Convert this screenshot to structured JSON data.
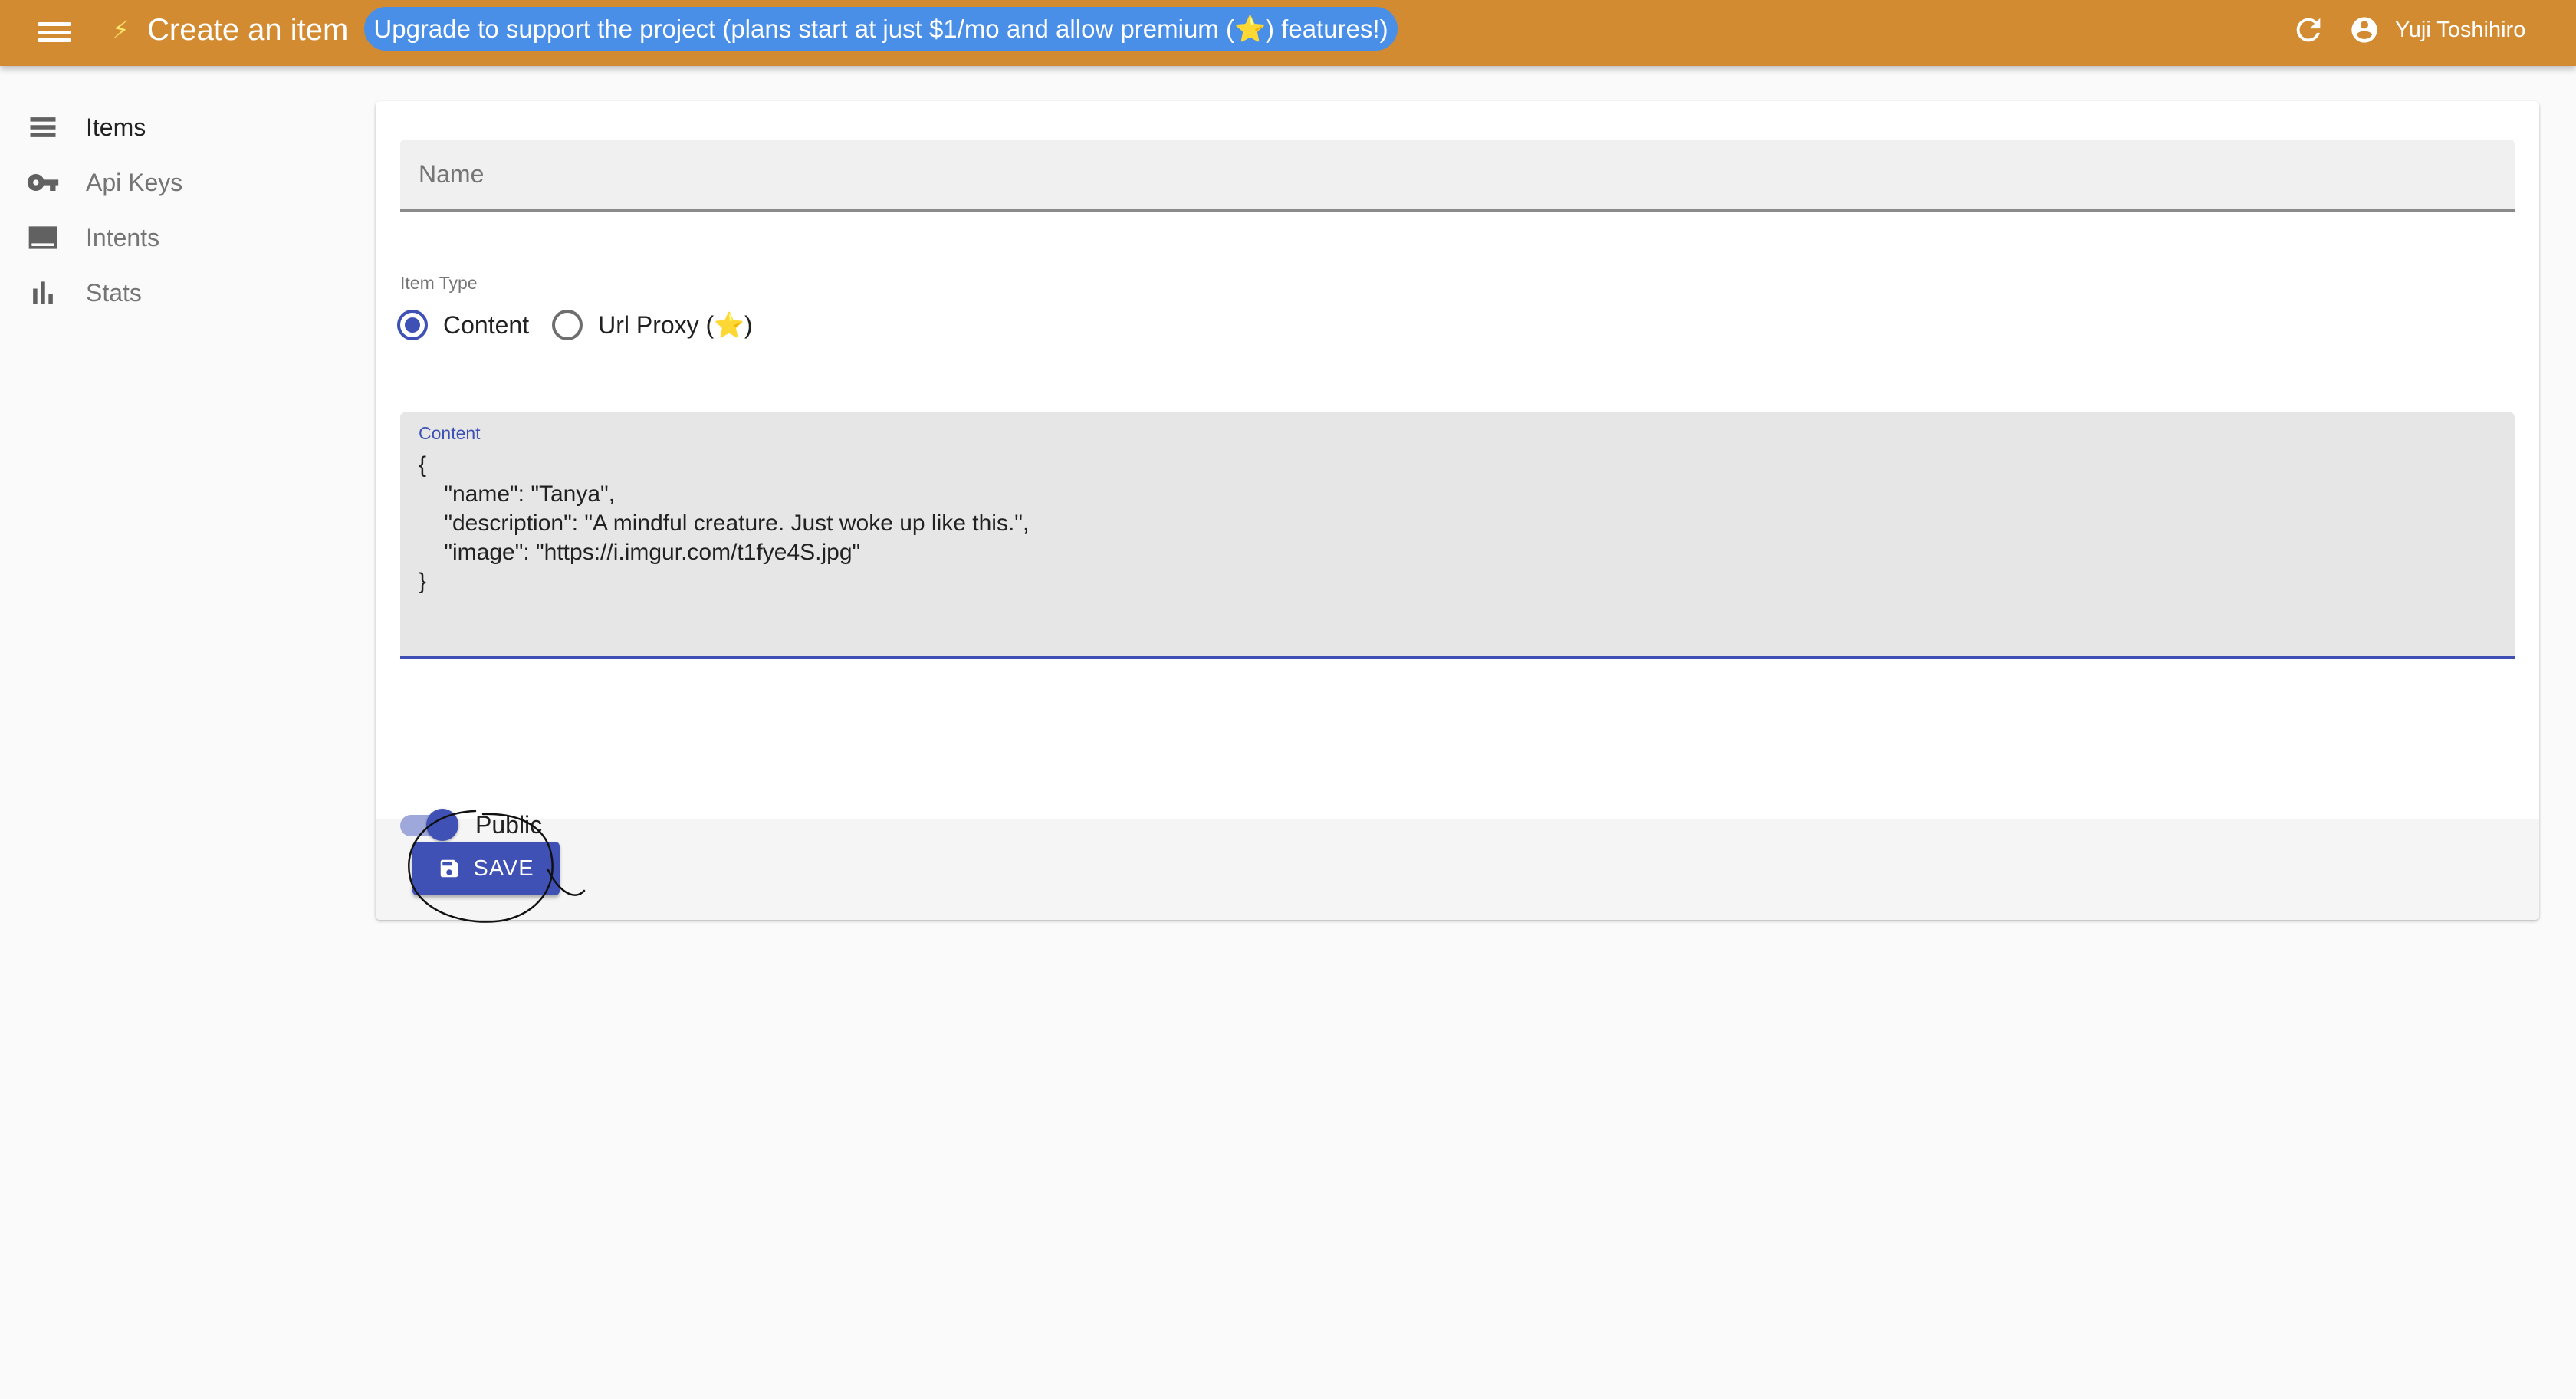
{
  "appbar": {
    "title": "Create an item",
    "bolt": "⚡",
    "upgrade_banner": "Upgrade to support the project (plans start at just $1/mo and allow premium (⭐) features!)",
    "user_name": "Yuji Toshihiro",
    "color": "#d38b31"
  },
  "sidebar": {
    "items": [
      {
        "label": "Items",
        "icon": "list-icon",
        "active": true
      },
      {
        "label": "Api Keys",
        "icon": "key-icon",
        "active": false
      },
      {
        "label": "Intents",
        "icon": "intents-icon",
        "active": false
      },
      {
        "label": "Stats",
        "icon": "bar-chart-icon",
        "active": false
      }
    ]
  },
  "form": {
    "name_placeholder": "Name",
    "name_value": "",
    "item_type_label": "Item Type",
    "item_types": [
      {
        "label": "Content",
        "selected": true
      },
      {
        "label": "Url Proxy (",
        "star": "⭐",
        "close": ")",
        "selected": false
      }
    ],
    "content_label": "Content",
    "content_value": "{\n    \"name\": \"Tanya\",\n    \"description\": \"A mindful creature. Just woke up like this.\",\n    \"image\": \"https://i.imgur.com/t1fye4S.jpg\"\n}",
    "public_label": "Public",
    "public_on": true,
    "save_label": "SAVE",
    "accent": "#3f51b5"
  }
}
